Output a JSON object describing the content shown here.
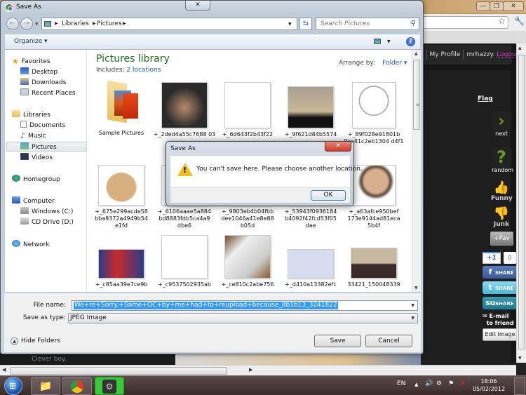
{
  "browser": {
    "minimize_icon": "—",
    "maximize_icon": "❐",
    "close_icon": "✕",
    "bookmark_icon": "☆",
    "wrench_icon": "🔧",
    "site": {
      "nav_partial": "t",
      "my_profile": "My Profile",
      "username": "mrhazzy.",
      "logout": "Logout",
      "flag": "Flag",
      "next_label": "next",
      "next_glyph": "›",
      "random_label": "random",
      "random_glyph": "?",
      "funny_label": "Funny",
      "junk_label": "Junk",
      "fav_label": "+Fav",
      "plus_one": "+1",
      "plus_one_count": "0",
      "share_facebook": "SHARE",
      "share_twitter": "SHARE",
      "share_stumble": "SHARE",
      "email_line1": "E-mail",
      "email_line2": "to friend",
      "edit_image": "Edit Image",
      "caption": "Clever boy."
    }
  },
  "dialog": {
    "title": "Save As",
    "close_icon": "✕",
    "breadcrumb": [
      "Libraries",
      "Pictures"
    ],
    "search_placeholder": "Search Pictures",
    "organize": "Organize ▾",
    "help": "?",
    "nav_pane": {
      "favorites": "Favorites",
      "desktop": "Desktop",
      "downloads": "Downloads",
      "recent_places": "Recent Places",
      "libraries": "Libraries",
      "documents": "Documents",
      "music": "Music",
      "pictures": "Pictures",
      "videos": "Videos",
      "homegroup": "Homegroup",
      "computer": "Computer",
      "windows_c": "Windows (C:)",
      "cd_drive_d": "CD Drive (D:)",
      "network": "Network"
    },
    "library_title": "Pictures library",
    "includes_label": "Includes:",
    "includes_link": "2 locations",
    "arrange_by_label": "Arrange by:",
    "arrange_by_value": "Folder ▾",
    "files": [
      {
        "name": "Sample Pictures"
      },
      {
        "name": "+_2ded4a55c7688 03"
      },
      {
        "name": "+_6d643f2b43f22"
      },
      {
        "name": "+_9f621d84b5574"
      },
      {
        "name": "+_89f028e91801b 9ce81c2eb1304 d4f1"
      },
      {
        "name": "+_675e299acde58 bba9372a4949b54 e1fd"
      },
      {
        "name": "+_6106aaae5a884 bd8883fdb5ca4a9 dbe6"
      },
      {
        "name": "+_9803eb4b04fbb dee1046a41e8e88 b05d"
      },
      {
        "name": "+_53943f0936184 b4092f42fcd53f05 dae"
      },
      {
        "name": "+_a63afce950bef 173e9144ad81eca 5b4f"
      },
      {
        "name": "+_c85aa39e7ce9b"
      },
      {
        "name": "+_c9537502935ab"
      },
      {
        "name": "+_ce810c2abe756"
      },
      {
        "name": "+_d410a13382efc"
      },
      {
        "name": "33421_150048339"
      }
    ],
    "file_name_label": "File name:",
    "file_name_value": "We+re+Sorry.+Same+OC+by+me+had+to+reupload+because_8b1b13_3241822",
    "save_type_label": "Save as type:",
    "save_type_value": "JPEG Image",
    "hide_folders": "Hide Folders",
    "save_button": "Save",
    "cancel_button": "Cancel"
  },
  "alert": {
    "title": "Save As",
    "close_icon": "✕",
    "message": "You can't save here. Please choose another location.",
    "ok_button": "OK"
  },
  "taskbar": {
    "language": "EN",
    "time": "18:06",
    "date": "05/02/2012"
  }
}
